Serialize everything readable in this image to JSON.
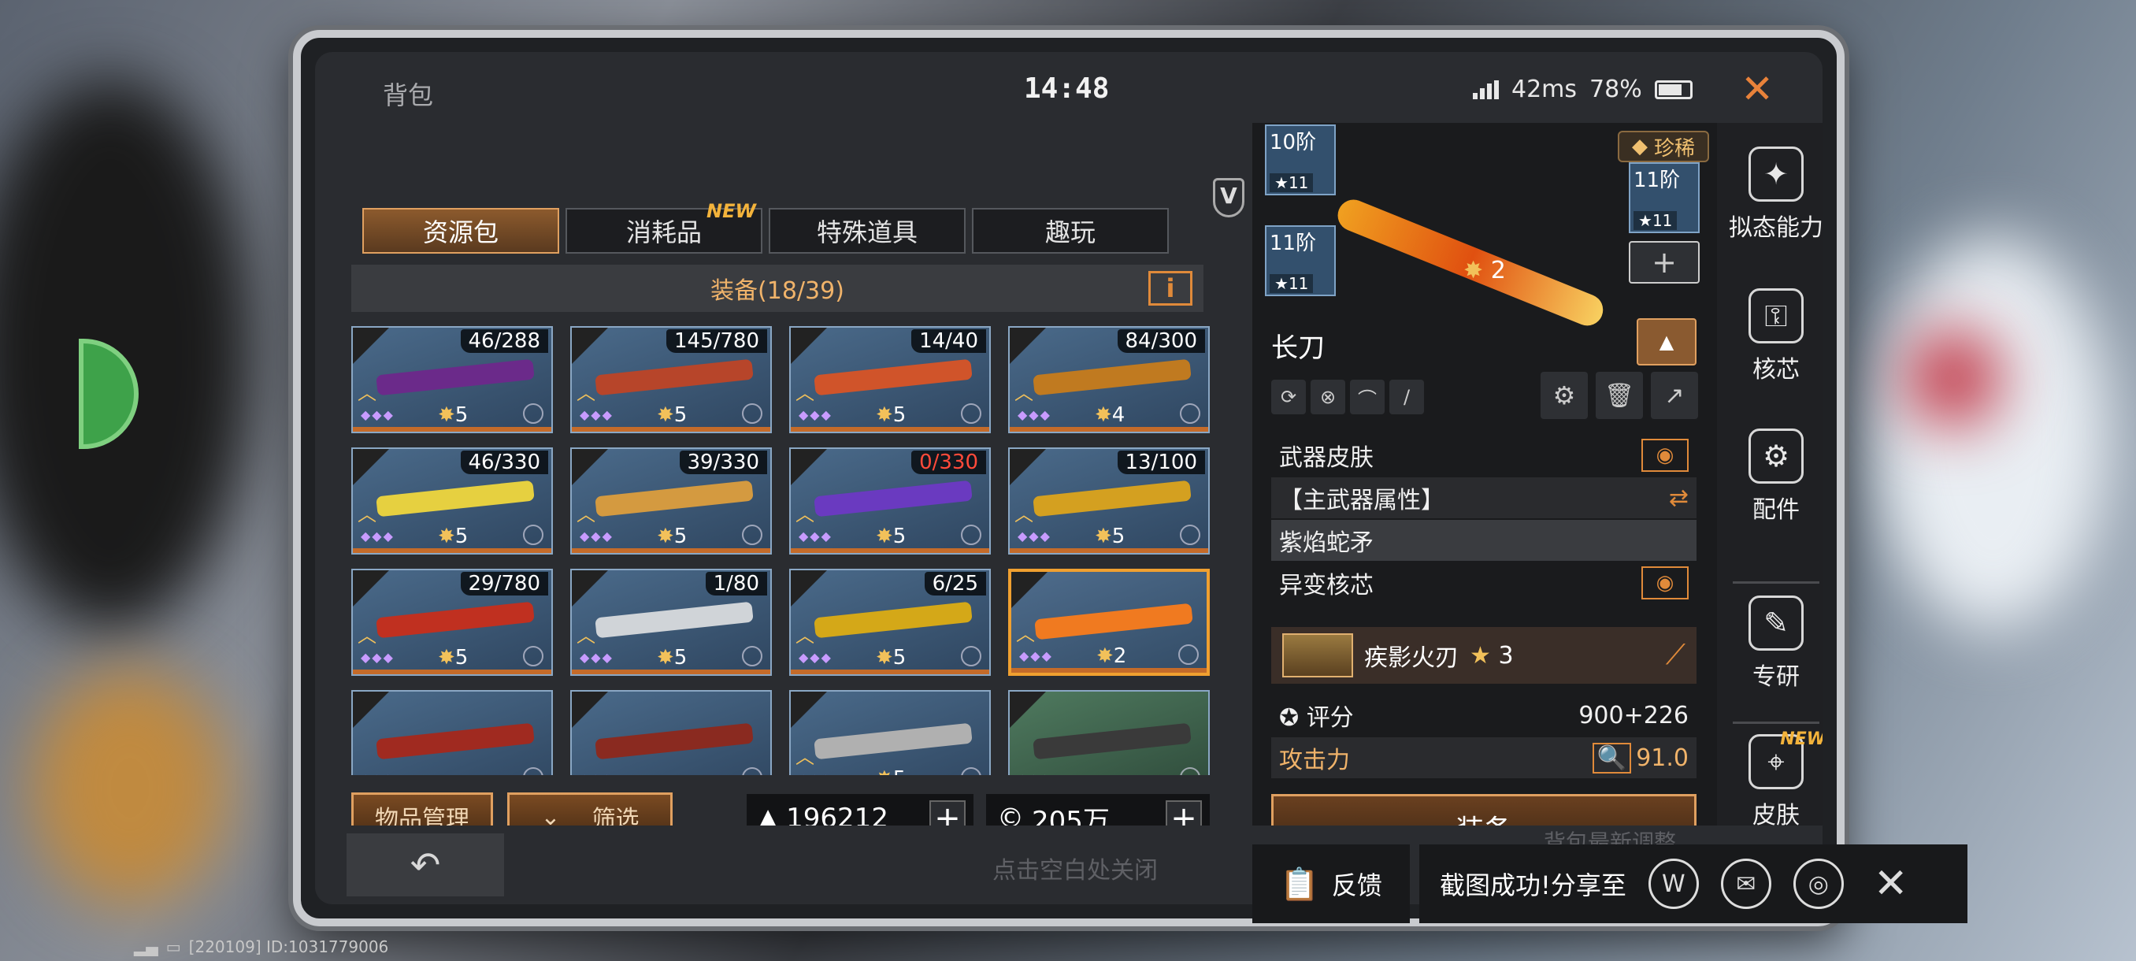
{
  "topbar": {
    "title": "背包",
    "clock": "14:48",
    "ping": "42ms",
    "battery": "78%",
    "battery_level": 0.78
  },
  "tabs": [
    {
      "label": "资源包",
      "active": true
    },
    {
      "label": "消耗品",
      "badge": "NEW"
    },
    {
      "label": "特殊道具"
    },
    {
      "label": "趣玩"
    }
  ],
  "section": {
    "title": "装备(18/39)",
    "info_icon": "info-icon"
  },
  "cards": [
    {
      "count": "46/288",
      "stars": "5",
      "color": "#6b2a8a"
    },
    {
      "count": "145/780",
      "stars": "5",
      "color": "#b7452a"
    },
    {
      "count": "14/40",
      "stars": "5",
      "color": "#d0542a"
    },
    {
      "count": "84/300",
      "stars": "4",
      "color": "#c07a20"
    },
    {
      "count": "46/330",
      "stars": "5",
      "color": "#e6d040"
    },
    {
      "count": "39/330",
      "stars": "5",
      "color": "#d49a40"
    },
    {
      "count": "0/330",
      "stars": "5",
      "color": "#6a3ac0",
      "red": true
    },
    {
      "count": "13/100",
      "stars": "5",
      "color": "#d4a020"
    },
    {
      "count": "29/780",
      "stars": "5",
      "color": "#c03020"
    },
    {
      "count": "1/80",
      "stars": "5",
      "color": "#d0d4d8"
    },
    {
      "count": "6/25",
      "stars": "5",
      "color": "#d4a818"
    },
    {
      "count": "",
      "stars": "2",
      "color": "#f07a20",
      "selected": true
    },
    {
      "count": "",
      "stars": "",
      "color": "#a02a20"
    },
    {
      "count": "",
      "stars": "",
      "color": "#8a2a20"
    },
    {
      "count": "",
      "stars": "5",
      "color": "#b0b0b0"
    },
    {
      "count": "",
      "stars": "",
      "color": "#3a3a3a",
      "green": true
    }
  ],
  "bottom_left": {
    "manage_label": "物品管理",
    "filter_label": "筛选"
  },
  "currencies": [
    {
      "icon": "ore-icon",
      "value": "196212"
    },
    {
      "icon": "coin-icon",
      "value": "205万"
    }
  ],
  "detail": {
    "tiers": [
      {
        "label": "10阶",
        "stars": "11"
      },
      {
        "label": "11阶",
        "stars": "11"
      },
      {
        "label": "11阶",
        "stars": "11"
      }
    ],
    "rarity": "珍稀",
    "star_level": "2",
    "name": "长刀",
    "rows": {
      "skin_label": "武器皮肤",
      "attr_label": "【主武器属性】",
      "skin_name": "紫焰蛇矛",
      "core_label": "异变核芯",
      "core_name": "疾影火刃",
      "core_stars": "3",
      "score_label": "评分",
      "score_value": "900+226",
      "attack_label": "攻击力",
      "attack_value": "91.0"
    },
    "equip_label": "装备"
  },
  "side_nav": [
    {
      "label": "拟态能力",
      "icon": "mimic-icon"
    },
    {
      "label": "核芯",
      "icon": "core-icon"
    },
    {
      "label": "配件",
      "icon": "attachment-icon"
    },
    {
      "label": "专研",
      "icon": "research-icon"
    },
    {
      "label": "皮肤",
      "icon": "skin-icon",
      "badge": "NEW"
    }
  ],
  "bottom": {
    "tap_close": "点击空白处关闭",
    "notice": "背包最新调整"
  },
  "toast": {
    "feedback_label": "反馈",
    "share_label": "截图成功!分享至"
  },
  "footer": {
    "build_id": "[220109] ID:1031779006"
  }
}
